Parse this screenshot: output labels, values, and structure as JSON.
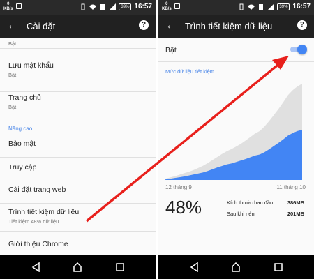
{
  "left": {
    "status": {
      "kb": "0\nKB/s",
      "battery": "39%",
      "time": "16:57"
    },
    "app_bar": {
      "title": "Cài đặt"
    },
    "items": [
      {
        "title": "",
        "subtitle": "Bật"
      },
      {
        "title": "Lưu mật khẩu",
        "subtitle": "Bật"
      },
      {
        "title": "Trang chủ",
        "subtitle": "Bật"
      },
      {
        "title": "Bảo mật",
        "subtitle": ""
      },
      {
        "title": "Truy cập",
        "subtitle": ""
      },
      {
        "title": "Cài đặt trang web",
        "subtitle": ""
      },
      {
        "title": "Trình tiết kiệm dữ liệu",
        "subtitle": "Tiết kiệm 48% dữ liệu"
      },
      {
        "title": "Giới thiệu Chrome",
        "subtitle": ""
      }
    ],
    "section_header": "Nâng cao"
  },
  "right": {
    "status": {
      "kb": "0\nKB/s",
      "battery": "39%",
      "time": "16:57"
    },
    "app_bar": {
      "title": "Trình tiết kiệm dữ liệu"
    },
    "toggle_label": "Bật",
    "toggle_on": true,
    "usage_title": "Mức dữ liệu tiết kiệm",
    "date_start": "12 tháng 9",
    "date_end": "11 tháng 10",
    "savings_percent": "48%",
    "stats": [
      {
        "label": "Kích thước ban đầu",
        "value": "386MB"
      },
      {
        "label": "Sau khi nén",
        "value": "201MB"
      }
    ],
    "chart_data": {
      "type": "area",
      "x": [
        0,
        1,
        2,
        3,
        4,
        5,
        6,
        7,
        8,
        9,
        10,
        11,
        12,
        13,
        14,
        15,
        16,
        17,
        18,
        19,
        20,
        21,
        22,
        23,
        24,
        25,
        26,
        27,
        28,
        29
      ],
      "series": [
        {
          "values": [
            5,
            10,
            15,
            21,
            27,
            33,
            40,
            48,
            57,
            68,
            80,
            92,
            104,
            115,
            124,
            134,
            145,
            158,
            172,
            186,
            196,
            214,
            236,
            260,
            285,
            312,
            340,
            360,
            375,
            386
          ],
          "color": "#e0e0e0"
        },
        {
          "values": [
            2,
            5,
            8,
            11,
            14,
            18,
            22,
            26,
            30,
            36,
            43,
            50,
            56,
            62,
            66,
            72,
            78,
            84,
            91,
            98,
            102,
            111,
            123,
            136,
            149,
            163,
            178,
            188,
            196,
            201
          ],
          "color": "#4285f4"
        }
      ],
      "xlabel": "",
      "ylabel": "",
      "ylim": [
        0,
        386
      ]
    },
    "colors": {
      "accent": "#4285f4",
      "light": "#e0e0e0"
    }
  },
  "icons": [
    "back-arrow-icon",
    "help-icon",
    "nav-back-icon",
    "nav-home-icon",
    "nav-recents-icon"
  ]
}
